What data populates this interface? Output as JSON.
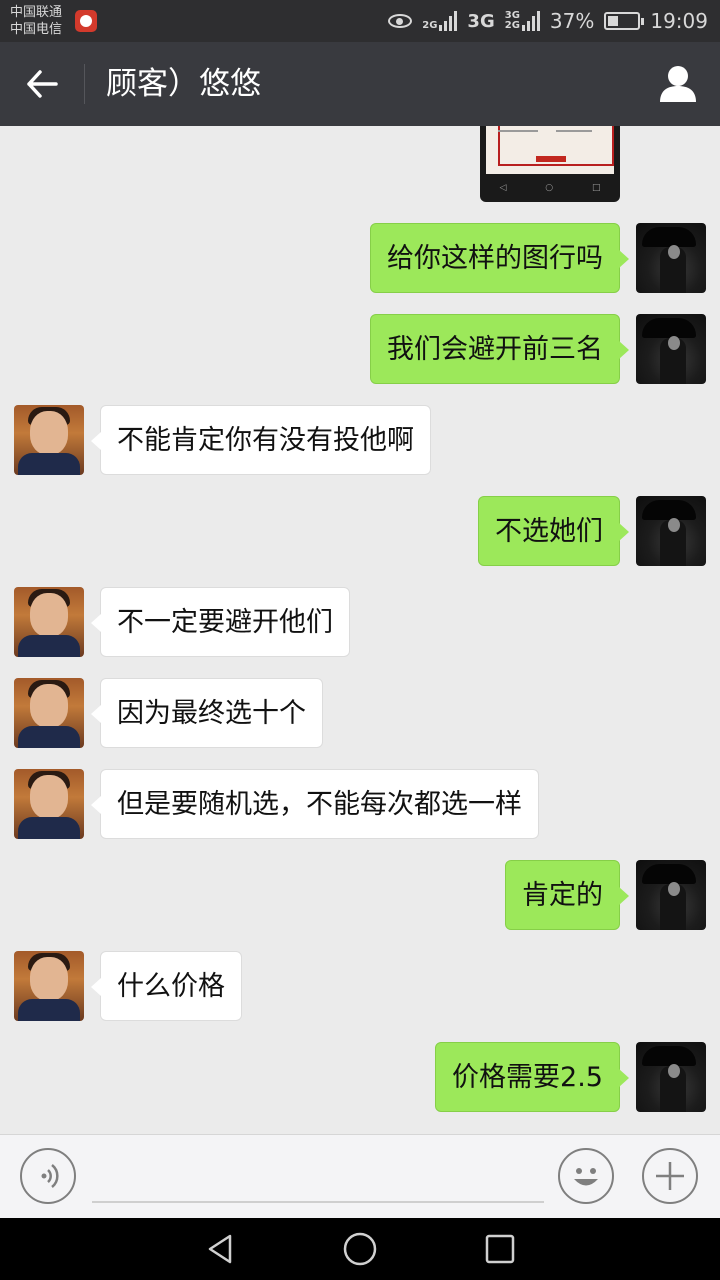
{
  "status_bar": {
    "carrier_1": "中国联通",
    "carrier_2": "中国电信",
    "net_2g": "2G",
    "net_3g": "3G",
    "net_3g_small": "3G",
    "net_2g_small": "2G",
    "battery": "37%",
    "battery_level": 0.37,
    "time": "19:09"
  },
  "header": {
    "title": "顾客）悠悠",
    "back_icon": "arrow-left-icon",
    "profile_icon": "person-icon"
  },
  "messages": [
    {
      "side": "right",
      "text": "给你这样的图行吗"
    },
    {
      "side": "right",
      "text": "我们会避开前三名"
    },
    {
      "side": "left",
      "text": "不能肯定你有没有投他啊"
    },
    {
      "side": "right",
      "text": "不选她们"
    },
    {
      "side": "left",
      "text": "不一定要避开他们"
    },
    {
      "side": "left",
      "text": "因为最终选十个"
    },
    {
      "side": "left",
      "text": "但是要随机选，不能每次都选一样"
    },
    {
      "side": "right",
      "text": "肯定的"
    },
    {
      "side": "left",
      "text": "什么价格"
    },
    {
      "side": "right",
      "text": "价格需要2.5"
    }
  ],
  "input_bar": {
    "voice_icon": "voice-icon",
    "emoji_icon": "emoji-icon",
    "plus_icon": "plus-icon",
    "input_value": ""
  },
  "colors": {
    "my_bubble": "#9ce85a",
    "other_bubble": "#ffffff",
    "header": "#393a3f",
    "chat_bg": "#ebebeb"
  }
}
